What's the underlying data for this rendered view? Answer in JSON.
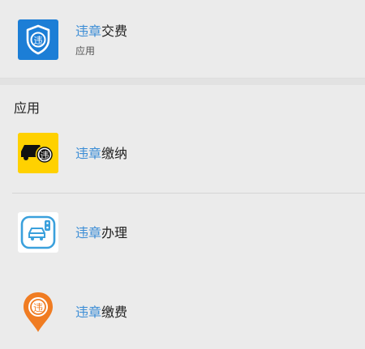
{
  "top_result": {
    "title_highlight": "违章",
    "title_rest": "交费",
    "subtitle": "应用",
    "icon": "shield-badge-icon",
    "icon_color": "#1c7ed6"
  },
  "section": {
    "title": "应用"
  },
  "apps": [
    {
      "title_highlight": "违章",
      "title_rest": "缴纳",
      "icon": "car-violation-icon",
      "icon_color": "#ffd100"
    },
    {
      "title_highlight": "违章",
      "title_rest": "办理",
      "icon": "car-traffic-light-icon",
      "icon_color": "#3aa0dc"
    },
    {
      "title_highlight": "违章",
      "title_rest": "缴费",
      "icon": "location-pin-icon",
      "icon_color": "#f07c22"
    }
  ],
  "colors": {
    "highlight": "#3d8ed6",
    "background": "#ebebeb"
  }
}
